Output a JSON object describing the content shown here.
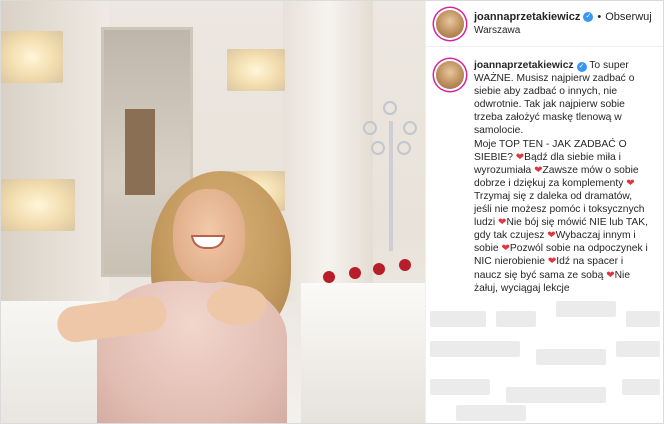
{
  "post": {
    "username": "joannaprzetakiewicz",
    "follow_label": "Obserwuj",
    "dot": "•",
    "location": "Warszawa",
    "verified_icon": "✓",
    "caption_segments": [
      {
        "t": " To super WAŻNE. Musisz najpierw zadbać o siebie aby zadbać o innych, nie odwrotnie. Tak jak najpierw sobie trzeba założyć maskę tlenową w samolocie."
      },
      {
        "br": true
      },
      {
        "t": "Moje TOP TEN - JAK ZADBAĆ O SIEBIE? "
      },
      {
        "h": "❤"
      },
      {
        "t": "Bądź dla siebie miła i wyrozumiała "
      },
      {
        "h": "❤"
      },
      {
        "t": "Zawsze mów o sobie dobrze i dziękuj za komplementy "
      },
      {
        "h": "❤"
      },
      {
        "t": "Trzymaj się z daleka od dramatów, jeśli nie możesz pomóc i toksycznych ludzi "
      },
      {
        "h": "❤"
      },
      {
        "t": "Nie bój się mówić NIE lub TAK, gdy tak czujesz "
      },
      {
        "h": "❤"
      },
      {
        "t": "Wybaczaj innym i sobie "
      },
      {
        "h": "❤"
      },
      {
        "t": "Pozwól sobie na odpoczynek i NIC nierobienie "
      },
      {
        "h": "❤"
      },
      {
        "t": "Idź na spacer i naucz się być sama ze sobą "
      },
      {
        "h": "❤"
      },
      {
        "t": "Nie żałuj, wyciągaj lekcje"
      }
    ]
  },
  "colors": {
    "verified_blue": "#3897f0",
    "heart_red": "#e0363f",
    "story_ring": "#d6249f"
  }
}
